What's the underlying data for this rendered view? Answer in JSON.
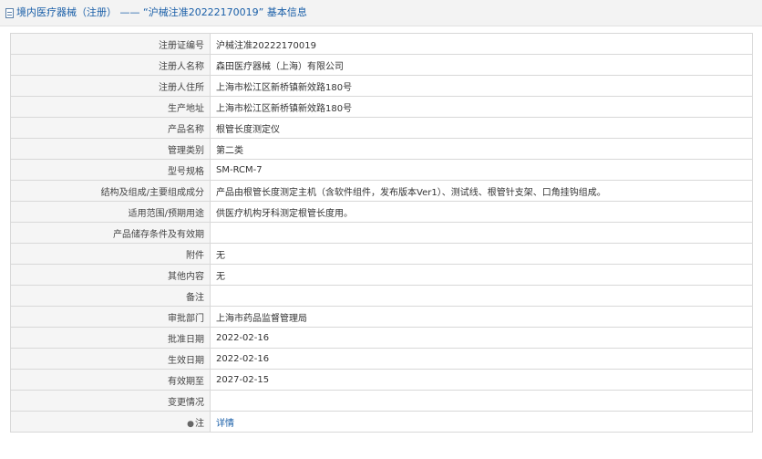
{
  "header": {
    "title": "境内医疗器械（注册） —— “沪械注准20222170019” 基本信息"
  },
  "rows": [
    {
      "label": "注册证编号",
      "value": "沪械注准20222170019"
    },
    {
      "label": "注册人名称",
      "value": "森田医疗器械（上海）有限公司"
    },
    {
      "label": "注册人住所",
      "value": "上海市松江区新桥镇新效路180号"
    },
    {
      "label": "生产地址",
      "value": "上海市松江区新桥镇新效路180号"
    },
    {
      "label": "产品名称",
      "value": "根管长度测定仪"
    },
    {
      "label": "管理类别",
      "value": "第二类"
    },
    {
      "label": "型号规格",
      "value": "SM-RCM-7"
    },
    {
      "label": "结构及组成/主要组成成分",
      "value": "产品由根管长度测定主机（含软件组件，发布版本Ver1）、测试线、根管针支架、口角挂钩组成。"
    },
    {
      "label": "适用范围/预期用途",
      "value": "供医疗机构牙科测定根管长度用。"
    },
    {
      "label": "产品储存条件及有效期",
      "value": ""
    },
    {
      "label": "附件",
      "value": "无"
    },
    {
      "label": "其他内容",
      "value": "无"
    },
    {
      "label": "备注",
      "value": ""
    },
    {
      "label": "审批部门",
      "value": "上海市药品监督管理局"
    },
    {
      "label": "批准日期",
      "value": "2022-02-16"
    },
    {
      "label": "生效日期",
      "value": "2022-02-16"
    },
    {
      "label": "有效期至",
      "value": "2027-02-15"
    },
    {
      "label": "变更情况",
      "value": ""
    }
  ],
  "note_row": {
    "label": "注",
    "link": "详情"
  }
}
